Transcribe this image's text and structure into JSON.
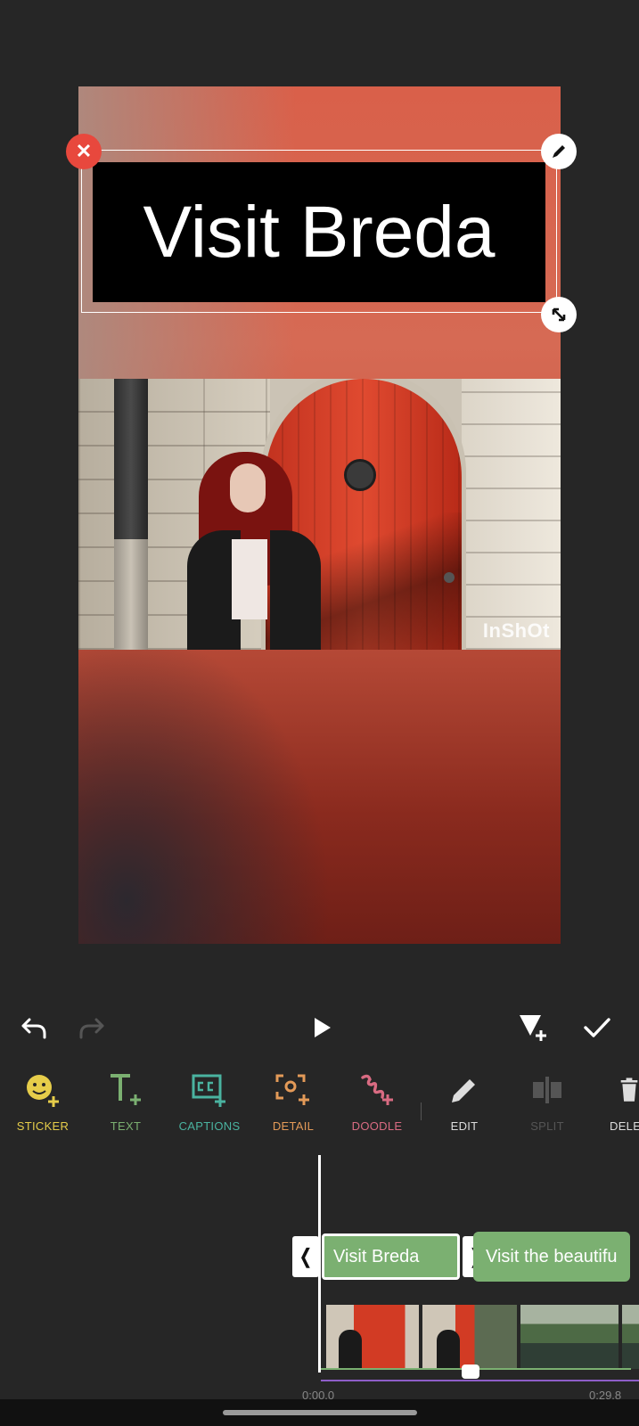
{
  "preview": {
    "text_overlay": "Visit Breda",
    "watermark": "InShOt"
  },
  "controls": {
    "undo": "undo",
    "redo": "redo",
    "play": "play",
    "add_keyframe": "add-keyframe",
    "confirm": "confirm"
  },
  "toolbar": {
    "items": [
      {
        "label": "STICKER",
        "color": "#e6cd4a"
      },
      {
        "label": "TEXT",
        "color": "#7bb071"
      },
      {
        "label": "CAPTIONS",
        "color": "#4ab3a0"
      },
      {
        "label": "DETAIL",
        "color": "#e39a58"
      },
      {
        "label": "DOODLE",
        "color": "#d96b82"
      },
      {
        "label": "EDIT",
        "color": "#dddddd"
      },
      {
        "label": "SPLIT",
        "color": "#555555"
      },
      {
        "label": "DELE",
        "color": "#dddddd"
      }
    ]
  },
  "timeline": {
    "selected_clip": "Visit Breda",
    "next_clip": "Visit the beautifu",
    "time_start": "0:00.0",
    "time_end": "0:29.8"
  }
}
